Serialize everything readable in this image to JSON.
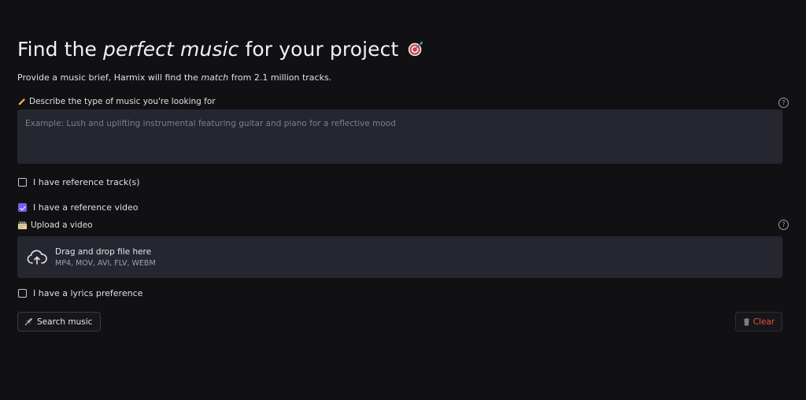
{
  "header": {
    "title_before": "Find the ",
    "title_emphasis": "perfect music",
    "title_after": " for your project",
    "title_icon": "direct-hit-target-icon",
    "subtitle_before": "Provide a music brief, Harmix will find the ",
    "subtitle_emphasis": "match",
    "subtitle_after": " from 2.1 million tracks."
  },
  "brief": {
    "label_icon": "pencil-icon",
    "label": "Describe the type of music you're looking for",
    "placeholder": "Example: Lush and uplifting instrumental featuring guitar and piano for a reflective mood",
    "value": "",
    "help_icon": "question-circle-icon"
  },
  "options": {
    "reference_tracks": {
      "label": "I have reference track(s)",
      "checked": false
    },
    "reference_video": {
      "label": "I have a reference video",
      "checked": true
    },
    "lyrics": {
      "label": "I have a lyrics preference",
      "checked": false
    }
  },
  "upload": {
    "label_icon": "clapper-board-icon",
    "label": "Upload a video",
    "help_icon": "question-circle-icon",
    "dropzone_icon": "cloud-upload-icon",
    "dropzone_title": "Drag and drop file here",
    "dropzone_formats": "MP4, MOV, AVI, FLV, WEBM"
  },
  "actions": {
    "search_icon": "rocket-icon",
    "search_label": "Search music",
    "clear_icon": "trash-icon",
    "clear_label": "Clear"
  },
  "colors": {
    "background": "#111114",
    "field_bg": "#252630",
    "accent": "#7b5cf0",
    "danger": "#e4553f"
  }
}
